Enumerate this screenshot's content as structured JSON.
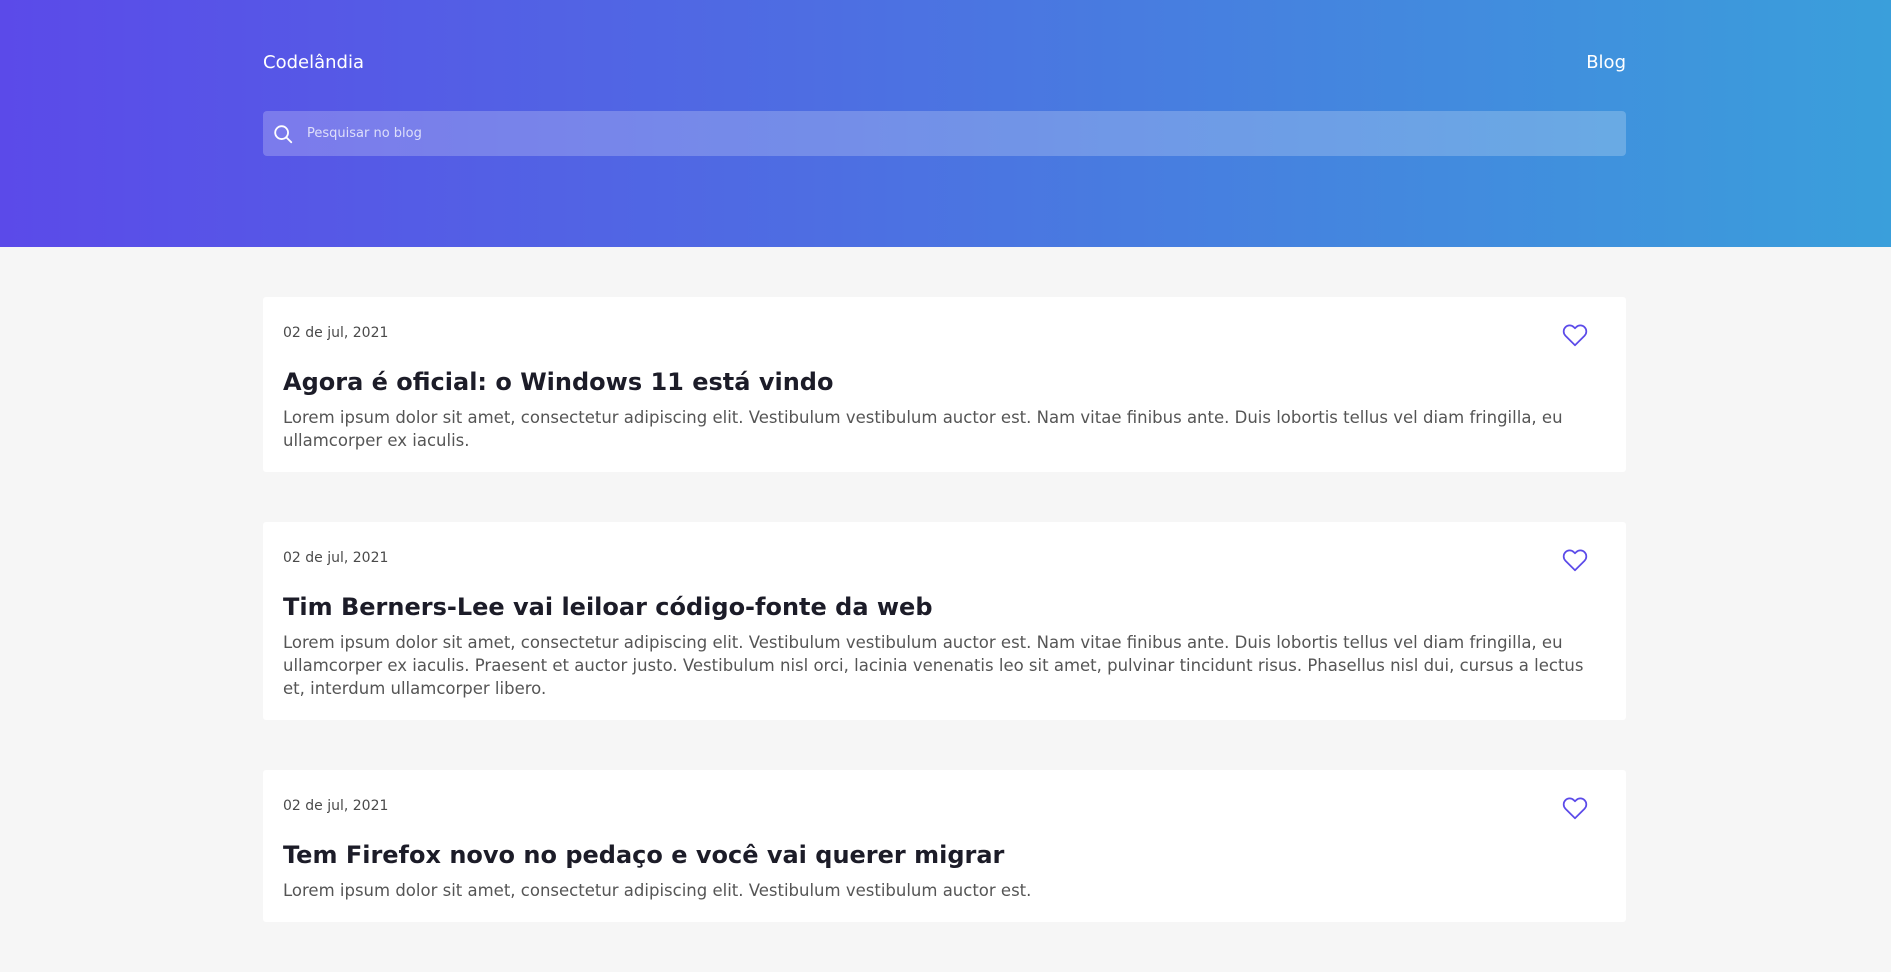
{
  "header": {
    "brand": "Codelândia",
    "nav_link": "Blog",
    "search_placeholder": "Pesquisar no blog",
    "gradient": [
      "#5b4ae9",
      "#3a9fdb"
    ]
  },
  "posts": [
    {
      "date": "02 de jul, 2021",
      "title": "Agora é oficial: o Windows 11 está vindo",
      "excerpt": "Lorem ipsum dolor sit amet, consectetur adipiscing elit. Vestibulum vestibulum auctor est. Nam vitae finibus ante. Duis lobortis tellus vel diam fringilla, eu ullamcorper ex iaculis."
    },
    {
      "date": "02 de jul, 2021",
      "title": "Tim Berners-Lee vai leiloar código-fonte da web",
      "excerpt": "Lorem ipsum dolor sit amet, consectetur adipiscing elit. Vestibulum vestibulum auctor est. Nam vitae finibus ante. Duis lobortis tellus vel diam fringilla, eu ullamcorper ex iaculis. Praesent et auctor justo. Vestibulum nisl orci, lacinia venenatis leo sit amet, pulvinar tincidunt risus. Phasellus nisl dui, cursus a lectus et, interdum ullamcorper libero."
    },
    {
      "date": "02 de jul, 2021",
      "title": "Tem Firefox novo no pedaço e você vai querer migrar",
      "excerpt": "Lorem ipsum dolor sit amet, consectetur adipiscing elit. Vestibulum vestibulum auctor est."
    }
  ],
  "icons": {
    "search": "search-icon",
    "like": "heart-icon"
  },
  "colors": {
    "accent": "#5b4ae9",
    "background": "#f6f6f6",
    "card": "#ffffff"
  }
}
